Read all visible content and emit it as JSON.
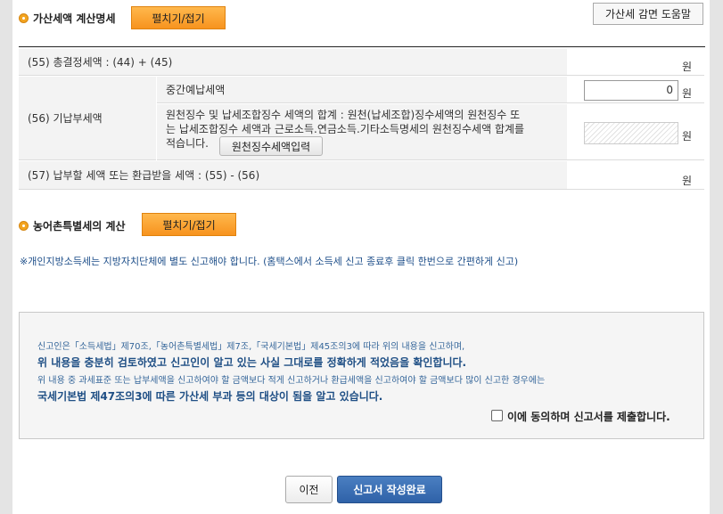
{
  "section1": {
    "title": "가산세액 계산명세",
    "toggle_label": "펼치기/접기",
    "help_button": "가산세 감면 도움말"
  },
  "rows": {
    "r55_label": "(55) 총결정세액 : (44) + (45)",
    "r55_unit": "원",
    "r56_label": "(56) 기납부세액",
    "interim_label": "중간예납세액",
    "interim_value": "0",
    "interim_unit": "원",
    "withholding_line1": "원천징수 및 납세조합징수 세액의 합계 : 원천(납세조합)징수세액의 원천징수 또",
    "withholding_line2": "는 납세조합징수 세액과 근로소득.연금소득.기타소득명세의 원천징수세액 합계를",
    "withholding_line3": "적습니다.",
    "withholding_button": "원천징수세액입력",
    "withholding_unit": "원",
    "r57_label": "(57) 납부할 세액 또는 환급받을 세액 : (55) - (56)",
    "r57_unit": "원"
  },
  "section2": {
    "title": "농어촌특별세의 계산",
    "toggle_label": "펼치기/접기"
  },
  "notice": {
    "strong": "※개인지방소득세는 지방자치단체에 별도 신고해야",
    "rest": " 합니다. (홈택스에서 소득세 신고 종료후 클릭 한번으로 간편하게 신고)"
  },
  "agreement": {
    "line1": "신고인은「소득세법」제70조,「농어촌특별세법」제7조,「국세기본법」제45조의3에 따라 위의 내용을 신고하며,",
    "line2": "위 내용을 충분히 검토하였고 신고인이 알고 있는 사실 그대로를 정확하게 적었음을 확인합니다.",
    "line3": "위 내용 중 과세표준 또는 납부세액을 신고하여야 할 금액보다 적게 신고하거나 환급세액을 신고하여야 할 금액보다 많이 신고한 경우에는",
    "line4": "국세기본법 제47조의3에 따른 가산세 부과 등의 대상이 됨을 알고 있습니다.",
    "checkbox_label": "이에 동의하며 신고서를 제출합니다."
  },
  "footer": {
    "prev_button": "이전",
    "submit_button": "신고서 작성완료"
  },
  "colors": {
    "accent_orange": "#f7931e",
    "submit_blue": "#2f62a8",
    "notice_blue": "#1e4f8a"
  }
}
